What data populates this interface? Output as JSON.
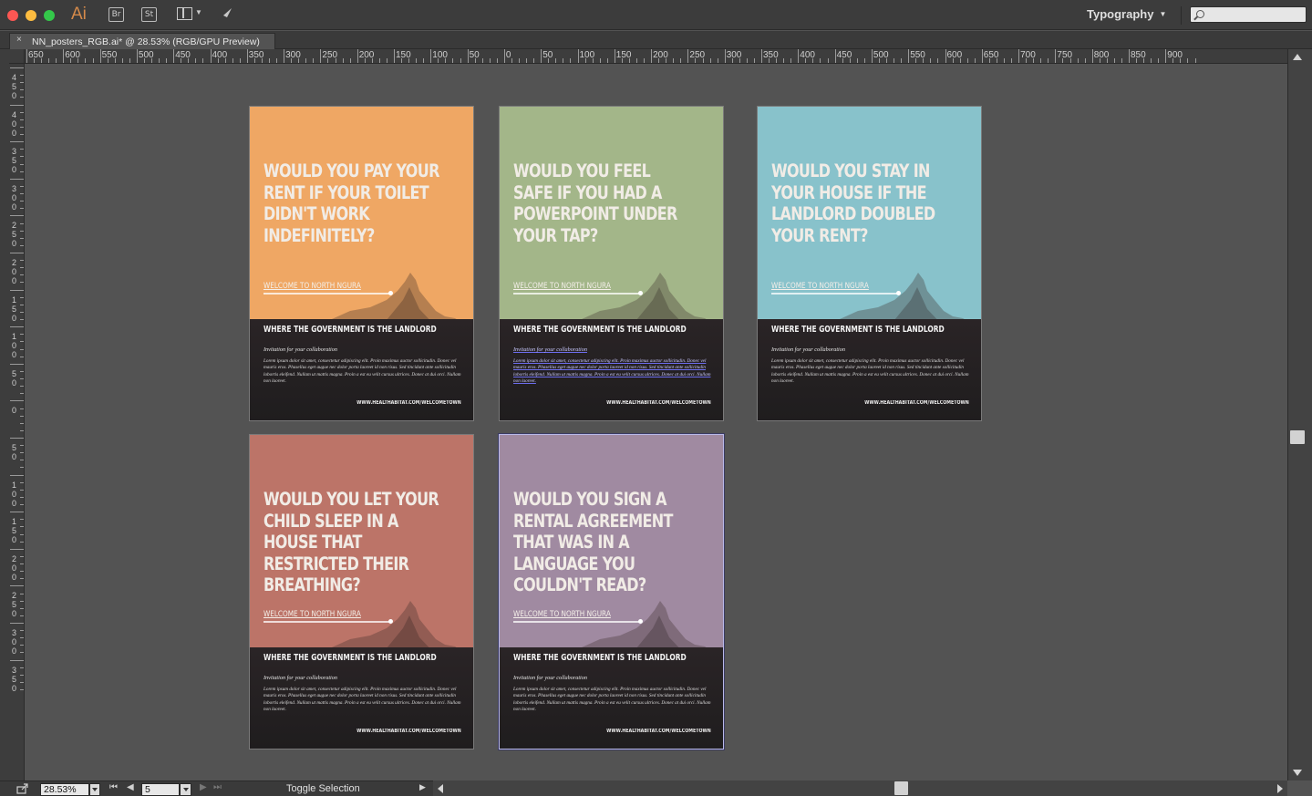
{
  "app": {
    "logo": "Ai",
    "bridge_label": "Br",
    "stock_label": "St",
    "workspace_label": "Typography",
    "search_placeholder": ""
  },
  "document_tab": {
    "close": "×",
    "title": "NN_posters_RGB.ai* @ 28.53% (RGB/GPU Preview)"
  },
  "rulers": {
    "horizontal_labels": [
      "650",
      "600",
      "550",
      "500",
      "450",
      "400",
      "350",
      "300",
      "250",
      "200",
      "150",
      "100",
      "50",
      "0",
      "50",
      "100",
      "150",
      "200",
      "250",
      "300",
      "350",
      "400",
      "450",
      "500",
      "550",
      "600",
      "650",
      "700",
      "750",
      "800",
      "850",
      "900"
    ],
    "vertical_labels": [
      "450",
      "400",
      "350",
      "300",
      "250",
      "200",
      "150",
      "100",
      "50",
      "0",
      "50",
      "100",
      "150",
      "200",
      "250",
      "300",
      "350"
    ]
  },
  "posters": [
    {
      "color": "#efa764",
      "question": "Would you pay your rent if your toilet didn't work indefinitely?",
      "welcome": "WELCOME TO NORTH NGURA",
      "landlord": "WHERE THE GOVERNMENT IS THE LANDLORD",
      "invite": "Invitation for your collaboration",
      "body": "Lorem ipsum dolor sit amet, consectetur adipiscing elit. Proin maximus auctor sollicitudin. Donec vel mauris eros. Phasellus eget augue nec dolor porta laoreet id non risus. Sed tincidunt ante sollicitudin lobortis eleifend. Nullam ut mattis magna. Proin a est eu velit cursus ultrices. Donec at dui orci. Nullam non laoreet.",
      "url": "WWW.HEALTHABITAT.COM/WELCOMETOWN",
      "selected": false,
      "highlighted": false
    },
    {
      "color": "#a3b689",
      "question": "Would you feel safe if you had a powerpoint under your tap?",
      "welcome": "WELCOME TO NORTH NGURA",
      "landlord": "WHERE THE GOVERNMENT IS THE LANDLORD",
      "invite": "Invitation for your collaboration",
      "body": "Lorem ipsum dolor sit amet, consectetur adipiscing elit. Proin maximus auctor sollicitudin. Donec vel mauris eros. Phasellus eget augue nec dolor porta laoreet id non risus. Sed tincidunt ante sollicitudin lobortis eleifend. Nullam ut mattis magna. Proin a est eu velit cursus ultrices. Donec at dui orci. Nullam non laoreet.",
      "url": "WWW.HEALTHABITAT.COM/WELCOMETOWN",
      "selected": false,
      "highlighted": true
    },
    {
      "color": "#88c2cb",
      "question": "Would you stay in your house if the landlord doubled your rent?",
      "welcome": "WELCOME TO NORTH NGURA",
      "landlord": "WHERE THE GOVERNMENT IS THE LANDLORD",
      "invite": "Invitation for your collaboration",
      "body": "Lorem ipsum dolor sit amet, consectetur adipiscing elit. Proin maximus auctor sollicitudin. Donec vel mauris eros. Phasellus eget augue nec dolor porta laoreet id non risus. Sed tincidunt ante sollicitudin lobortis eleifend. Nullam ut mattis magna. Proin a est eu velit cursus ultrices. Donec at dui orci. Nullam non laoreet.",
      "url": "WWW.HEALTHABITAT.COM/WELCOMETOWN",
      "selected": false,
      "highlighted": false
    },
    {
      "color": "#bc7468",
      "question": "Would you let your child sleep in a house that restricted their breathing?",
      "welcome": "WELCOME TO NORTH NGURA",
      "landlord": "WHERE THE GOVERNMENT IS THE LANDLORD",
      "invite": "Invitation for your collaboration",
      "body": "Lorem ipsum dolor sit amet, consectetur adipiscing elit. Proin maximus auctor sollicitudin. Donec vel mauris eros. Phasellus eget augue nec dolor porta laoreet id non risus. Sed tincidunt ante sollicitudin lobortis eleifend. Nullam ut mattis magna. Proin a est eu velit cursus ultrices. Donec at dui orci. Nullam non laoreet.",
      "url": "WWW.HEALTHABITAT.COM/WELCOMETOWN",
      "selected": false,
      "highlighted": false
    },
    {
      "color": "#a08aa1",
      "question": "Would you sign a rental agreement that was in a language you couldn't read?",
      "welcome": "WELCOME TO NORTH NGURA",
      "landlord": "WHERE THE GOVERNMENT IS THE LANDLORD",
      "invite": "Invitation for your collaboration",
      "body": "Lorem ipsum dolor sit amet, consectetur adipiscing elit. Proin maximus auctor sollicitudin. Donec vel mauris eros. Phasellus eget augue nec dolor porta laoreet id non risus. Sed tincidunt ante sollicitudin lobortis eleifend. Nullam ut mattis magna. Proin a est eu velit cursus ultrices. Donec at dui orci. Nullam non laoreet.",
      "url": "WWW.HEALTHABITAT.COM/WELCOMETOWN",
      "selected": true,
      "highlighted": false
    }
  ],
  "status": {
    "zoom": "28.53%",
    "page": "5",
    "toggle_label": "Toggle Selection",
    "nav_first": "⏮",
    "nav_prev": "◀",
    "nav_next": "▶",
    "nav_last": "⏭"
  }
}
